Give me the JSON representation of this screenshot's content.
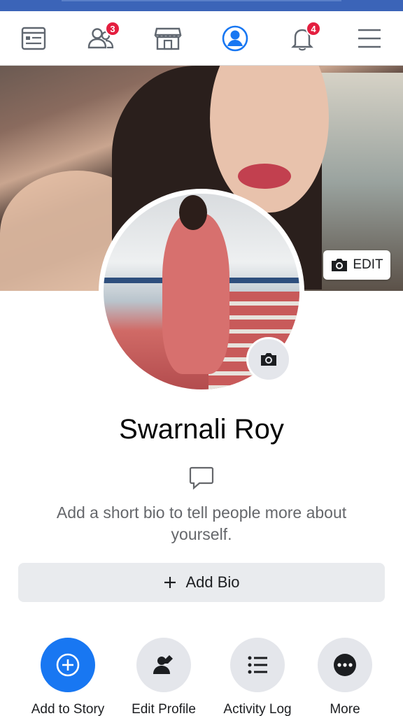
{
  "nav": {
    "items": [
      {
        "name": "news-feed",
        "badge": ""
      },
      {
        "name": "friend-requests",
        "badge": "3"
      },
      {
        "name": "marketplace",
        "badge": ""
      },
      {
        "name": "profile",
        "badge": ""
      },
      {
        "name": "notifications",
        "badge": "4"
      },
      {
        "name": "menu",
        "badge": ""
      }
    ],
    "active_color": "#1877f2",
    "badge_color": "#e41e3f"
  },
  "cover": {
    "edit_label": "EDIT"
  },
  "profile": {
    "name": "Swarnali Roy",
    "bio_prompt": "Add a short bio to tell people more about yourself.",
    "add_bio_label": "Add Bio"
  },
  "actions": [
    {
      "label": "Add to Story",
      "icon": "plus-icon"
    },
    {
      "label": "Edit Profile",
      "icon": "edit-profile-icon"
    },
    {
      "label": "Activity Log",
      "icon": "list-icon"
    },
    {
      "label": "More",
      "icon": "more-icon"
    }
  ]
}
